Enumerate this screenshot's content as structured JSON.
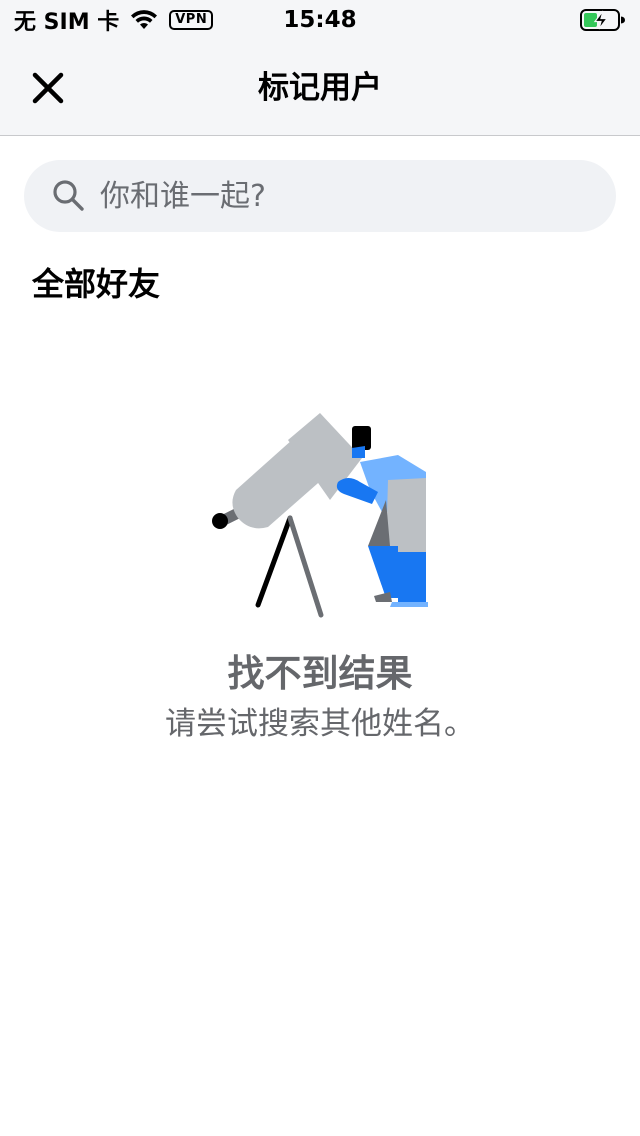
{
  "status_bar": {
    "carrier": "无 SIM 卡",
    "vpn": "VPN",
    "time": "15:48",
    "icons": [
      "wifi-icon",
      "battery-charging-icon"
    ],
    "battery_color": "#34c759"
  },
  "header": {
    "title": "标记用户",
    "close_icon": "close-icon"
  },
  "search": {
    "placeholder": "你和谁一起?",
    "value": "",
    "icon": "search-icon"
  },
  "section": {
    "title": "全部好友"
  },
  "empty_state": {
    "illustration": "telescope-person-illustration",
    "title": "找不到结果",
    "subtitle": "请尝试搜索其他姓名。"
  },
  "colors": {
    "header_bg": "#f5f6f8",
    "search_bg": "#f0f2f5",
    "secondary_text": "#65676b",
    "accent_blue": "#1877f2",
    "light_blue": "#73b3ff",
    "gray": "#bcc0c4"
  }
}
